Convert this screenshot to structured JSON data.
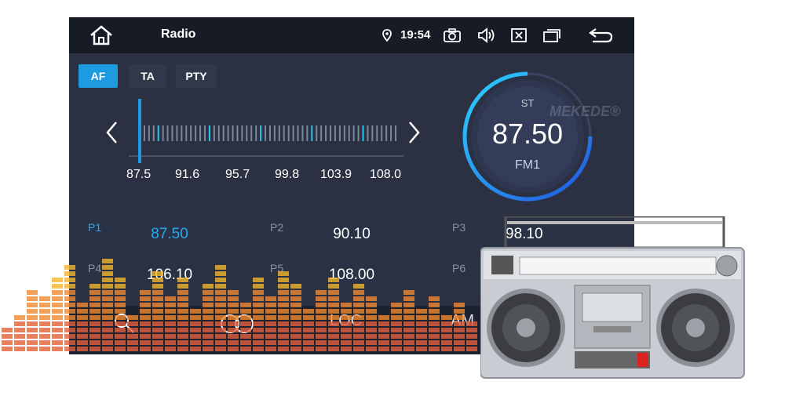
{
  "header": {
    "title": "Radio",
    "time": "19:54",
    "icons": [
      "home-icon",
      "location-icon",
      "camera-icon",
      "volume-icon",
      "close-box-icon",
      "window-icon",
      "back-icon"
    ]
  },
  "mode_buttons": {
    "af": "AF",
    "ta": "TA",
    "pty": "PTY",
    "active": "AF"
  },
  "tuner": {
    "scale_labels": [
      "87.5",
      "91.6",
      "95.7",
      "99.8",
      "103.9",
      "108.0"
    ],
    "current_fraction": 0.0
  },
  "dial": {
    "stereo": "ST",
    "frequency": "87.50",
    "band": "FM1"
  },
  "presets": [
    {
      "id": "P1",
      "freq": "87.50",
      "selected": true
    },
    {
      "id": "P2",
      "freq": "90.10",
      "selected": false
    },
    {
      "id": "P3",
      "freq": "98.10",
      "selected": false
    },
    {
      "id": "P4",
      "freq": "106.10",
      "selected": false
    },
    {
      "id": "P5",
      "freq": "108.00",
      "selected": false
    },
    {
      "id": "P6",
      "freq": "",
      "selected": false
    }
  ],
  "bottom": {
    "loc": "LOC",
    "am": "AM"
  },
  "watermark": "MEKEDE®",
  "colors": {
    "accent": "#1e9ae0",
    "background": "#2b3142",
    "topbar": "#161b26"
  }
}
